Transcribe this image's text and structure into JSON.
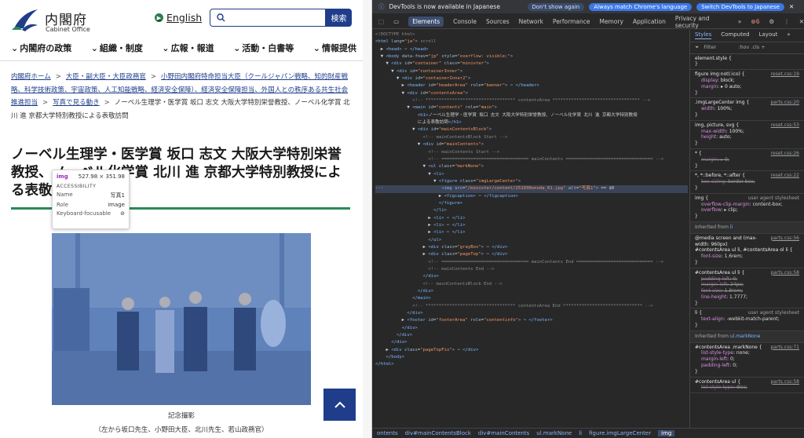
{
  "site": {
    "logo_title": "内閣府",
    "logo_sub": "Cabinet Office",
    "lang_label": "English",
    "search_button": "検索",
    "nav": [
      "内閣府の政策",
      "組織・制度",
      "広報・報道",
      "活動・白書等",
      "情報提供"
    ],
    "breadcrumb": [
      {
        "text": "内閣府ホーム",
        "link": true
      },
      {
        "text": "大臣・副大臣・大臣政務官",
        "link": true
      },
      {
        "text": "小野田内閣府特命担当大臣（クールジャパン戦略、知的財産戦略、科学技術政策、宇宙政策、人工知能戦略、経済安全保障）、経済安全保障担当、外国人との秩序ある共生社会推進担当",
        "link": true
      },
      {
        "text": "写真で見る動き",
        "link": true
      },
      {
        "text": "ノーベル生理学・医学賞 坂口 志文 大阪大学特別栄誉教授、ノーベル化学賞 北川 進 京都大学特別教授による表敬訪問",
        "link": false
      }
    ],
    "heading_line1": "ノーベル生理学・医学賞 坂口 志文 大阪大学特別栄誉",
    "heading_line2": "教授、ノーベル化学賞 北川 進 京都大学特別教授によ",
    "heading_line3": "る表敬訪問",
    "caption1": "記念撮影",
    "caption2": "（左から坂口先生、小野田大臣、北川先生、若山政務官）"
  },
  "tooltip": {
    "tag": "img",
    "size": "527.98 × 351.98",
    "section": "ACCESSIBILITY",
    "rows": [
      {
        "key": "Name",
        "value": "写真1"
      },
      {
        "key": "Role",
        "value": "image"
      },
      {
        "key": "Keyboard-focusable",
        "value": "⊘"
      }
    ]
  },
  "devtools": {
    "notice": "DevTools is now available in Japanese",
    "btn_dont_show": "Don't show again",
    "btn_match": "Always match Chrome's language",
    "btn_switch": "Switch DevTools to Japanese",
    "tabs": [
      "Elements",
      "Console",
      "Sources",
      "Network",
      "Performance",
      "Memory",
      "Application",
      "Privacy and security",
      "»"
    ],
    "error_count": "6",
    "styles_tabs": [
      "Styles",
      "Computed",
      "Layout",
      "»"
    ],
    "filter_placeholder": "Filter",
    "filter_buttons": ":hov  .cls  +",
    "bottom_crumbs": [
      "ontents",
      "div#mainContentsBlock",
      "div#mainContents",
      "ul.markNone",
      "li",
      "figure.imgLargeCenter",
      "img"
    ]
  },
  "colors": {
    "brand_blue": "#1f3d8a",
    "brand_green": "#2a8a55",
    "devtools_bg": "#282828"
  }
}
